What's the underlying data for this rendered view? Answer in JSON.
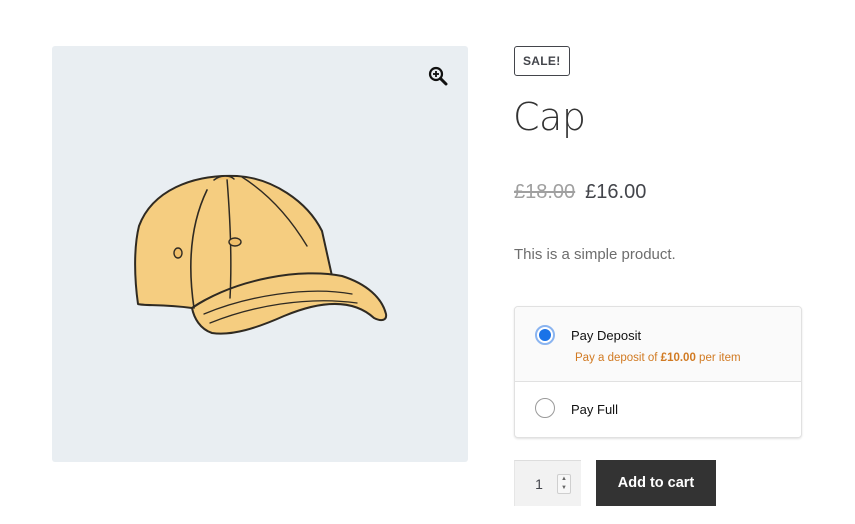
{
  "product": {
    "title": "Cap",
    "sale_badge": "SALE!",
    "regular_price": "£18.00",
    "sale_price": "£16.00",
    "short_description": "This is a simple product."
  },
  "gallery": {
    "zoom_icon": "magnifier-plus-icon",
    "image_subject": "cap"
  },
  "deposit_options": {
    "selected": "deposit",
    "deposit": {
      "label": "Pay Deposit",
      "note_prefix": "Pay a deposit of ",
      "note_amount": "£10.00",
      "note_suffix": " per item"
    },
    "full": {
      "label": "Pay Full"
    }
  },
  "cart": {
    "quantity": "1",
    "button_label": "Add to cart"
  },
  "colors": {
    "gallery_background": "#e9eef2",
    "deposit_note": "#d17a22",
    "radio_selected": "#1a73e8",
    "button_background": "#333333",
    "cap": "#f5cd80"
  }
}
